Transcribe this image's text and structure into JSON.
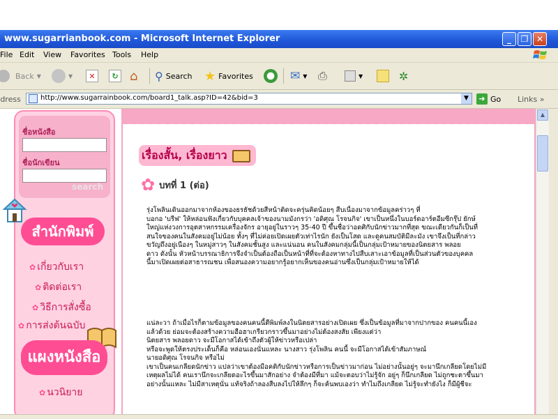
{
  "window": {
    "title": "www.sugarrianbook.com - Microsoft Internet Explorer"
  },
  "menu": [
    "File",
    "Edit",
    "View",
    "Favorites",
    "Tools",
    "Help"
  ],
  "toolbar": {
    "back": "Back",
    "search": "Search",
    "favorites": "Favorites"
  },
  "address": {
    "label": "Address",
    "url": "http://www.sugarrainbook.com/board1_talk.asp?ID=42&bid=3",
    "go": "Go",
    "links": "Links"
  },
  "sidebar": {
    "book_name_label": "ชื่อหนังสือ",
    "author_label": "ชื่อนักเขียน",
    "search_button": "search",
    "publisher_title": "สำนักพิมพ์",
    "nav": [
      "เกี่ยวกับเรา",
      "ติดต่อเรา",
      "วิธีการสั่งซื้อ",
      "การส่งต้นฉบับ"
    ],
    "bookshelf_title": "แผงหนังสือ",
    "categories": [
      "นวนิยาย"
    ]
  },
  "content": {
    "heading": "เรื่องสั้น, เรื่องยาว",
    "chapter": "บทที่ 1 (ต่อ)",
    "para1": "รุ่งโพลินเดินออกมาจากห้องของธรธัชด้วยสีหน้าติดจะครุ่นคิดน้อยๆ สืบเนื่องมาจากข้อมูลคร่าวๆ ที่\nบอกอ 'บรีฟ' ให้หล่อนฟังเกี่ยวกับบุคคลเจ้าของนามมังกรว่า 'อดิศุณ โรจนกิจ' เขาเป็นหนึ่งในบอร์ดอาร์ตอีมซีกรุ๊ป ยักษ์\nใหญ่แห่งวงการอุตสาหกรรมเครื่องจักร อายุอยู่ในราวๆ 35-40 ปี ขึ้นชื่อว่าอดศิกับนักข่าวมากที่สุด ขณะเดียวกันก็เป็นที่\nสนใจของคนในสังคมอยู่ไม่น้อย ทั้งๆ ที่ไม่ค่อยเปิดเผยตัวเท่าไรนัก ยังเป็นโสด และดูคนสมบัติมีละมัง เขาจึงเป็นที่กล่าว\nขวัญถึงอยู่เนืองๆ ในหมู่สาวๆ ในสังคมชั้นสูง และแน่นอน คนในสังคมกลุ่มนี้เป็นกลุ่มเป้าหมายของนิตยสาร พลอย\nดาว ดังนั้น หัวหน้าบรรณาธิการจึงจำเป็นต้องถือเป็นหน้าที่ที่จะต้องหาทางไปสืบเสาะเอาข้อมูลที่เป็นส่วนตัวของบุคคล\nนี้มาเปิดเผยต่อสาธารณชน เพื่อสนองความอยากรู้อยากเห็นของคนอ่านซึ่งเป็นกลุ่มเป้าหมายให้ได้",
    "para2": "แน่ละวา ถ้าเมื่อไรก็ตามข้อมูลของคนคนนี้ตีพิมพ์ลงในนิตยสารอย่างเปิดเผย ซึ่งเป็นข้อมูลที่มาจากปากของ คนคนนี้เอง\nแล้วด้วย ย่อมจะต้องสร้างความฮือฮาเกรียวกราวขึ้นมาอย่างไม่ต้องสงสัย เพียงแต่ว่า\nนิตยสาร พลอยดาว จะมีโอกาสได้เข้าถึงตัวผู้ให้ข่าวหรือเปล่า\nหรือจะพูดให้ตรงประเด็นก็คือ หล่อนเองนั่นแหละ นางสาว รุ่งโพลิน คนนี้ จะมีโอกาสได้เข้าสัมภาษณ์\nนายอดิศุณ โรจนกิจ หรือไม่\nเขาเป็นคนเกลียดนักข่าว แปลว่าเขาต้องมีอคติกับนักข่าวหรือการเป็นข่าวมาก่อน ไม่อย่างนั้นอยู่ๆ จะมานึกเกลียดโดยไม่มี\nเหตุผลไม่ได้ คนเรานึกจะเกลียดอะไรขึ้นมาสักอย่าง จำต้องมีที่มา แม้จะตอบว่าไม่รู้จัก อยู่ๆ ก็นึกเกลียด ไม่ถูกชะตาขึ้นมา\nอย่างนั้นแหละ ไม่มีสาเหตุนั่น แท้จริงถ้าลองสืบลงไปให้ลึกๆ ก็จะค้นพบเองว่า ทำไมถึงเกลียด ไม่รู้จะทำยังไง ก็มีผู้ชีจะ"
  },
  "colors": {
    "accent": "#ff4d94",
    "sidebar_bg": "#ffd2e2",
    "heading_text": "#b5004a",
    "titlebar": "#1f56d8"
  }
}
